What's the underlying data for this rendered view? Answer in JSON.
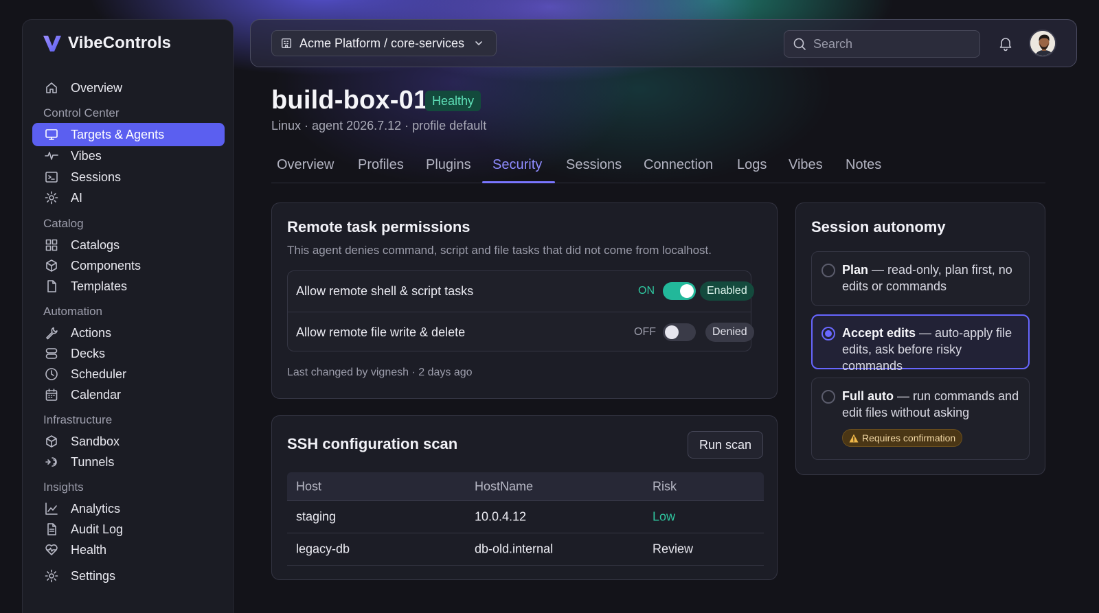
{
  "app": {
    "name": "VibeControls"
  },
  "sidebar": {
    "top_item": {
      "label": "Overview",
      "icon": "home-icon"
    },
    "sections": [
      {
        "title": "Control Center",
        "items": [
          {
            "label": "Targets & Agents",
            "icon": "monitor-icon",
            "active": true
          },
          {
            "label": "Vibes",
            "icon": "pulse-icon"
          },
          {
            "label": "Sessions",
            "icon": "terminal-icon"
          },
          {
            "label": "AI",
            "icon": "gear-icon"
          }
        ]
      },
      {
        "title": "Catalog",
        "items": [
          {
            "label": "Catalogs",
            "icon": "grid-icon"
          },
          {
            "label": "Components",
            "icon": "cube-icon"
          },
          {
            "label": "Templates",
            "icon": "file-icon"
          }
        ]
      },
      {
        "title": "Automation",
        "items": [
          {
            "label": "Actions",
            "icon": "wrench-icon"
          },
          {
            "label": "Decks",
            "icon": "stack-icon"
          },
          {
            "label": "Scheduler",
            "icon": "clock-icon"
          },
          {
            "label": "Calendar",
            "icon": "calendar-icon"
          }
        ]
      },
      {
        "title": "Infrastructure",
        "items": [
          {
            "label": "Sandbox",
            "icon": "cube-icon"
          },
          {
            "label": "Tunnels",
            "icon": "tunnel-icon"
          }
        ]
      },
      {
        "title": "Insights",
        "items": [
          {
            "label": "Analytics",
            "icon": "chart-icon"
          },
          {
            "label": "Audit Log",
            "icon": "document-icon"
          },
          {
            "label": "Health",
            "icon": "heartbeat-icon"
          }
        ]
      }
    ],
    "settings": {
      "label": "Settings",
      "icon": "gear-icon"
    }
  },
  "topbar": {
    "project": "Acme Platform / core-services",
    "search_placeholder": "Search"
  },
  "target": {
    "name": "build-box-01",
    "status": "Healthy",
    "meta": "Linux · agent 2026.7.12 · profile default"
  },
  "tabs": [
    "Overview",
    "Profiles",
    "Plugins",
    "Security",
    "Sessions",
    "Connection",
    "Logs",
    "Vibes",
    "Notes"
  ],
  "active_tab": "Security",
  "permissions": {
    "title": "Remote task permissions",
    "description": "This agent denies command, script and file tasks that did not come from localhost.",
    "rows": [
      {
        "label": "Allow remote shell & script tasks",
        "state": "ON",
        "badge": "Enabled",
        "on": true
      },
      {
        "label": "Allow remote file write & delete",
        "state": "OFF",
        "badge": "Denied",
        "on": false
      }
    ],
    "footer": "Last changed by vignesh · 2 days ago"
  },
  "ssh_scan": {
    "title": "SSH configuration scan",
    "button": "Run scan",
    "columns": [
      "Host",
      "HostName",
      "Risk"
    ],
    "rows": [
      {
        "host": "staging",
        "hostname": "10.0.4.12",
        "risk": "Low"
      },
      {
        "host": "legacy-db",
        "hostname": "db-old.internal",
        "risk": "Review"
      }
    ]
  },
  "autonomy": {
    "title": "Session autonomy",
    "options": [
      {
        "name": "Plan",
        "desc": " — read-only, plan first, no edits or commands",
        "selected": false
      },
      {
        "name": "Accept edits",
        "desc": " — auto-apply file edits, ask before risky commands",
        "selected": true
      },
      {
        "name": "Full auto",
        "desc": " — run commands and edit files without asking",
        "selected": false,
        "warning": "Requires confirmation"
      }
    ]
  },
  "colors": {
    "accent": "#5b5ff0",
    "success": "#27c2a0",
    "low_risk": "#2fc7a0",
    "warning": "#f0b84a"
  }
}
